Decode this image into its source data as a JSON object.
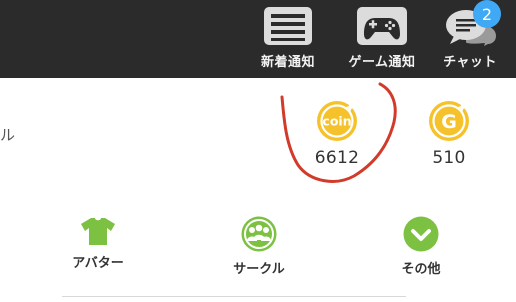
{
  "header": {
    "news": {
      "label": "新着通知",
      "icon": "news-list-icon"
    },
    "game": {
      "label": "ゲーム通知",
      "icon": "gamepad-icon"
    },
    "chat": {
      "label": "チャット",
      "icon": "chat-bubble-icon",
      "badge": "2"
    }
  },
  "edge_text": "ル",
  "currencies": {
    "coin": {
      "icon_text": "coin",
      "value": "6612"
    },
    "gold": {
      "icon_text": "G",
      "value": "510"
    }
  },
  "menu": {
    "avatar": {
      "label": "アバター",
      "icon": "shirt-icon"
    },
    "circle": {
      "label": "サークル",
      "icon": "group-icon"
    },
    "other": {
      "label": "その他",
      "icon": "chevron-down-icon"
    }
  },
  "colors": {
    "header_bg": "#2b2b2b",
    "coin_yellow": "#f6c22b",
    "menu_green": "#7cc142",
    "badge_blue": "#3fa9f5",
    "annotation_red": "#d23a2a"
  }
}
